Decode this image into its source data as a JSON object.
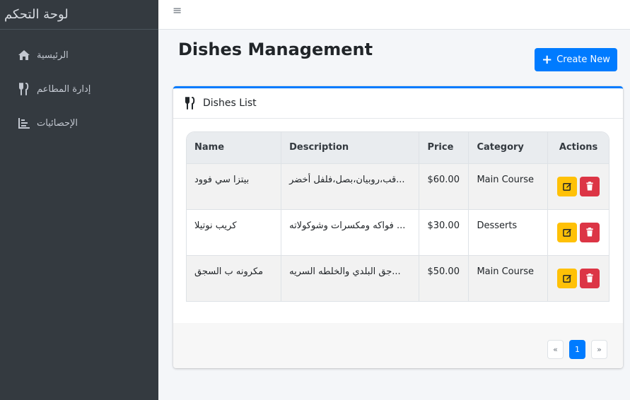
{
  "sidebar": {
    "brand": "لوحة التحكم",
    "items": [
      {
        "label": "الرئيسية",
        "icon": "home-icon"
      },
      {
        "label": "إدارة المطاعم",
        "icon": "utensils-icon"
      },
      {
        "label": "الإحصائيات",
        "icon": "chart-bars-icon"
      }
    ]
  },
  "topbar": {
    "menu_icon": "≡"
  },
  "main": {
    "title": "Dishes Management",
    "create_label": "Create New"
  },
  "card": {
    "title": "Dishes List",
    "columns": [
      "Name",
      "Description",
      "Price",
      "Category",
      "Actions"
    ],
    "rows": [
      {
        "name": "بيتزا سي فوود",
        "description": "...قب،روبيان،بصل،فلفل أخضر",
        "price": "$60.00",
        "category": "Main Course"
      },
      {
        "name": "كريب نوتيلا",
        "description": "... فواكه ومكسرات وشوكولاته",
        "price": "$30.00",
        "category": "Desserts"
      },
      {
        "name": "مكرونه ب السجق",
        "description": "...جق البلدي والخلطه السريه",
        "price": "$50.00",
        "category": "Main Course"
      }
    ]
  },
  "pagination": {
    "prev": "«",
    "current": "1",
    "next": "»"
  },
  "colors": {
    "accent": "#007bff",
    "sidebar_bg": "#343a40",
    "edit": "#ffc107",
    "delete": "#dc3545"
  }
}
